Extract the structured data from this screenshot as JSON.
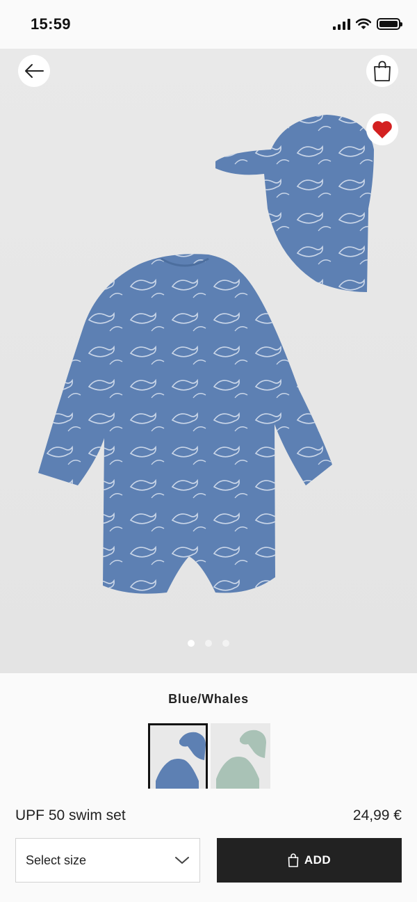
{
  "status_bar": {
    "time": "15:59"
  },
  "header": {
    "back_icon": "arrow-left-icon",
    "bag_icon": "shopping-bag-icon",
    "favorite_icon": "heart-icon",
    "favorite_color": "#d32020"
  },
  "gallery": {
    "total_images": 3,
    "active_index": 0
  },
  "color": {
    "name": "Blue/Whales",
    "swatches": [
      {
        "name": "Blue/Whales",
        "color": "#5d80b3",
        "selected": true
      },
      {
        "name": "Green",
        "color": "#a9c2b6",
        "selected": false
      }
    ]
  },
  "product": {
    "name": "UPF 50 swim set",
    "price": "24,99 €"
  },
  "actions": {
    "size_placeholder": "Select size",
    "add_label": "ADD"
  }
}
